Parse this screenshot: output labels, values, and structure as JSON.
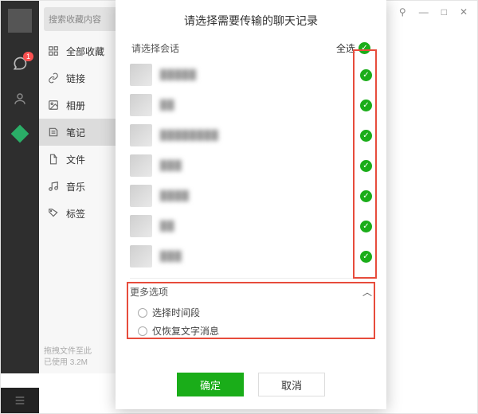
{
  "window": {
    "controls": {
      "pin": "⚲",
      "min": "—",
      "max": "□",
      "close": "✕"
    }
  },
  "deep_sidebar": {
    "chat_badge": "1"
  },
  "sidebar": {
    "search_placeholder": "搜索收藏内容",
    "items": [
      {
        "label": "全部收藏",
        "icon": "grid"
      },
      {
        "label": "链接",
        "icon": "link"
      },
      {
        "label": "相册",
        "icon": "image"
      },
      {
        "label": "笔记",
        "icon": "note",
        "active": true
      },
      {
        "label": "文件",
        "icon": "file"
      },
      {
        "label": "音乐",
        "icon": "music"
      },
      {
        "label": "标签",
        "icon": "tag"
      }
    ],
    "footer_line1": "拖拽文件至此",
    "footer_line2": "已使用 3.2M"
  },
  "dialog": {
    "title": "请选择需要传输的聊天记录",
    "select_session_label": "请选择会话",
    "select_all_label": "全选",
    "conversations": [
      {
        "name": "▉▉▉▉▉"
      },
      {
        "name": "▉▉"
      },
      {
        "name": "▉▉▉▉▉▉▉▉"
      },
      {
        "name": "▉▉▉"
      },
      {
        "name": "▉▉▉▉"
      },
      {
        "name": "▉▉"
      },
      {
        "name": "▉▉▉"
      }
    ],
    "more_options_label": "更多选项",
    "options": [
      {
        "label": "选择时间段"
      },
      {
        "label": "仅恢复文字消息"
      }
    ],
    "ok_label": "确定",
    "cancel_label": "取消"
  }
}
